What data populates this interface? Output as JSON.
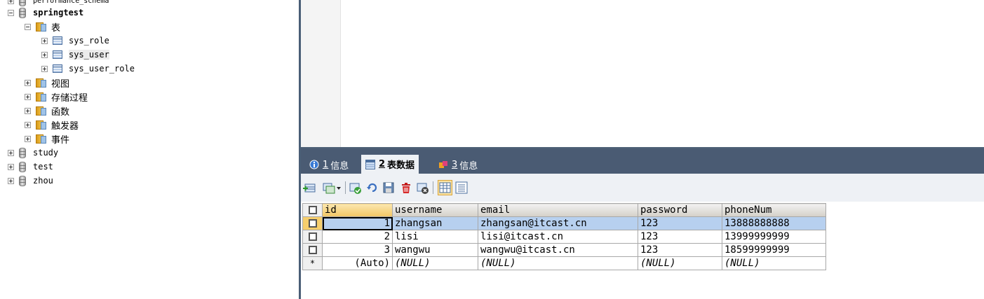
{
  "tree": {
    "top_partial": "performance_schema",
    "db": "springtest",
    "tables_folder": "表",
    "tables": [
      "sys_role",
      "sys_user",
      "sys_user_role"
    ],
    "folders": [
      "视图",
      "存储过程",
      "函数",
      "触发器",
      "事件"
    ],
    "other_dbs": [
      "study",
      "test",
      "zhou"
    ]
  },
  "tabs": [
    {
      "num": "1",
      "label": "信息"
    },
    {
      "num": "2",
      "label": "表数据"
    },
    {
      "num": "3",
      "label": "信息"
    }
  ],
  "grid": {
    "columns": [
      "id",
      "username",
      "email",
      "password",
      "phoneNum"
    ],
    "rows": [
      [
        "1",
        "zhangsan",
        "zhangsan@itcast.cn",
        "123",
        "13888888888"
      ],
      [
        "2",
        "lisi",
        "lisi@itcast.cn",
        "123",
        "13999999999"
      ],
      [
        "3",
        "wangwu",
        "wangwu@itcast.cn",
        "123",
        "18599999999"
      ]
    ],
    "new_row": {
      "marker": "*",
      "cells": [
        "(Auto)",
        "(NULL)",
        "(NULL)",
        "(NULL)",
        "(NULL)"
      ]
    }
  },
  "colors": {
    "tabbar": "#4a5b73",
    "selected_row": "#b7d0ef",
    "header_id": "#f2c764"
  }
}
